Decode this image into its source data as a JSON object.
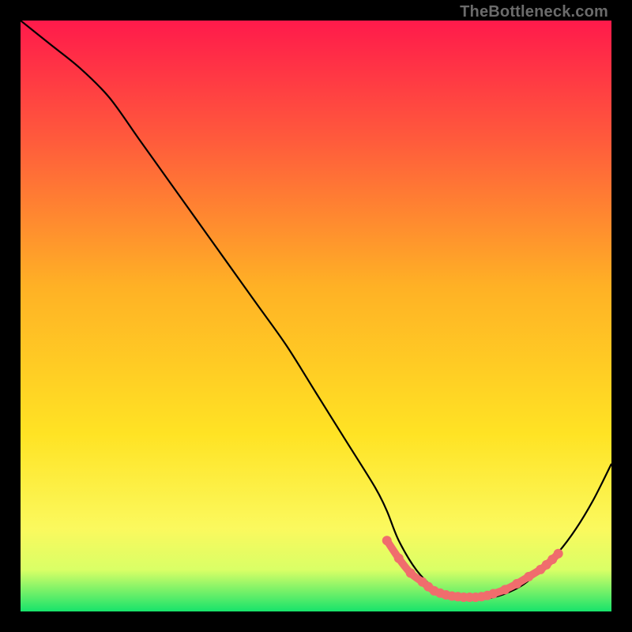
{
  "attribution": "TheBottleneck.com",
  "chart_data": {
    "type": "line",
    "title": "",
    "xlabel": "",
    "ylabel": "",
    "xlim": [
      0,
      100
    ],
    "ylim": [
      0,
      100
    ],
    "background_gradient": {
      "stops": [
        {
          "offset": 0.0,
          "color": "#ff1a4b"
        },
        {
          "offset": 0.2,
          "color": "#ff5a3c"
        },
        {
          "offset": 0.45,
          "color": "#ffb125"
        },
        {
          "offset": 0.7,
          "color": "#ffe324"
        },
        {
          "offset": 0.86,
          "color": "#fbf95e"
        },
        {
          "offset": 0.93,
          "color": "#d9ff66"
        },
        {
          "offset": 1.0,
          "color": "#17e36b"
        }
      ]
    },
    "series": [
      {
        "name": "bottleneck-curve",
        "color": "#000000",
        "x": [
          0,
          5,
          10,
          15,
          20,
          25,
          30,
          35,
          40,
          45,
          50,
          55,
          60,
          62,
          64,
          67,
          70,
          73,
          76,
          79,
          82,
          85,
          88,
          91,
          94,
          97,
          100
        ],
        "y": [
          100,
          96,
          92,
          87,
          80,
          73,
          66,
          59,
          52,
          45,
          37,
          29,
          21,
          17,
          12,
          7,
          4,
          2.5,
          2,
          2.2,
          3,
          4.5,
          7,
          10,
          14,
          19,
          25
        ]
      },
      {
        "name": "optimal-zone-markers",
        "color": "#f06d6d",
        "marker_size": 6,
        "x": [
          62,
          64,
          66,
          68,
          69,
          70,
          71,
          72,
          73,
          74,
          75,
          76,
          77,
          78,
          79,
          80,
          82,
          84,
          86,
          88,
          89,
          90,
          91
        ],
        "y": [
          12,
          9,
          6.5,
          5,
          4.2,
          3.5,
          3.1,
          2.8,
          2.6,
          2.5,
          2.4,
          2.4,
          2.4,
          2.5,
          2.7,
          3.0,
          3.7,
          4.7,
          5.9,
          7.1,
          7.9,
          8.8,
          9.8
        ]
      }
    ]
  }
}
